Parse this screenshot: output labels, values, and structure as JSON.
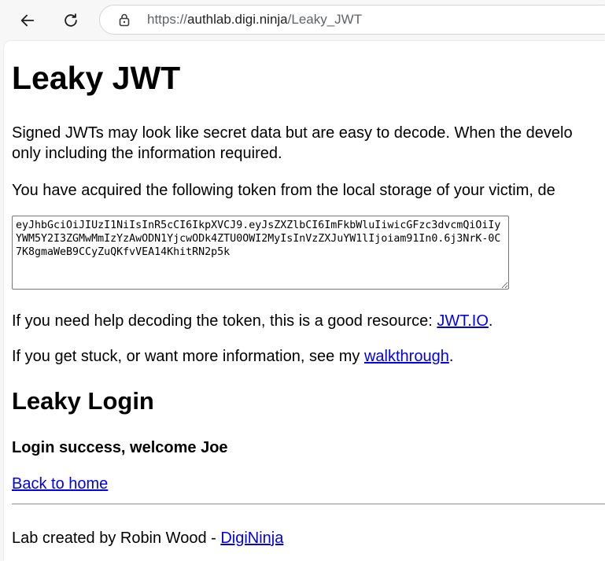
{
  "browser": {
    "url_protocol": "https://",
    "url_host": "authlab.digi.ninja",
    "url_path": "/Leaky_JWT"
  },
  "page": {
    "title": "Leaky JWT",
    "intro_line1": "Signed JWTs may look like secret data but are easy to decode. When the develo",
    "intro_line2": "only including the information required.",
    "acquired_text": "You have acquired the following token from the local storage of your victim, de",
    "token": "eyJhbGciOiJIUzI1NiIsInR5cCI6IkpXVCJ9.eyJsZXZlbCI6ImFkbWluIiwicGFzc3dvcmQiOiIyYWM5Y2I3ZGMwMmIzYzAwODN1YjcwODk4ZTU0OWI2MyIsInVzZXJuYW1lIjoiam91In0.6j3NrK-0C7K8gmaWeB9CCyZuQKfvVEA14KhitRN2p5k",
    "help_prefix": "If you need help decoding the token, this is a good resource: ",
    "help_link": "JWT.IO",
    "help_suffix": ".",
    "stuck_prefix": "If you get stuck, or want more information, see my ",
    "stuck_link": "walkthrough",
    "stuck_suffix": ".",
    "section_title": "Leaky Login",
    "success_message": "Login success, welcome Joe",
    "back_link": "Back to home",
    "footer_prefix": "Lab created by Robin Wood - ",
    "footer_link": "DigiNinja"
  },
  "icons": {
    "back": "arrow-left-icon",
    "reload": "reload-icon",
    "site_info": "lock-icon"
  },
  "colors": {
    "link": "#0000ee",
    "chrome_background": "#f7f7f7"
  }
}
